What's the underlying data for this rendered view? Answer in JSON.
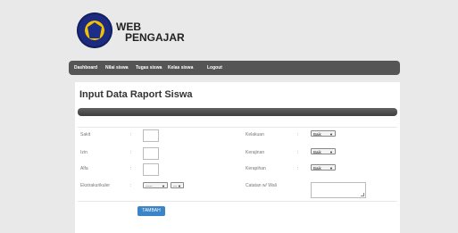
{
  "brand": {
    "line1": "WEB",
    "line2": "PENGAJAR"
  },
  "nav": [
    "Dashboard",
    "Nilai siswa",
    "Tugas siswa",
    "Kelas siswa",
    "Logout"
  ],
  "page_title": "Input Data Raport Siswa",
  "form": {
    "left": [
      {
        "label": "Sakit"
      },
      {
        "label": "Izin"
      },
      {
        "label": "Alfa"
      },
      {
        "label": "Ekstrakurikuler",
        "select1": "-----",
        "select2": "---"
      }
    ],
    "right": [
      {
        "label": "Kelakuan",
        "value": "Baik"
      },
      {
        "label": "Kerajinan",
        "value": "Baik"
      },
      {
        "label": "Kerapihan",
        "value": "Baik"
      },
      {
        "label": "Catatan w/ Wali"
      }
    ],
    "colon": ":",
    "submit": "TAMBAH"
  }
}
